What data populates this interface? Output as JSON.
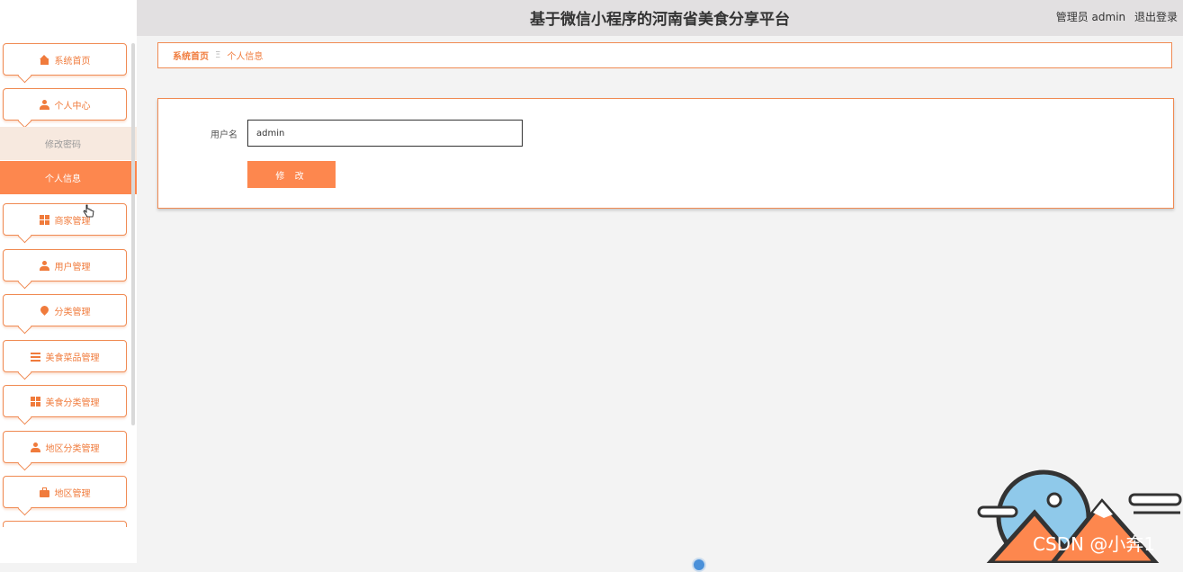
{
  "header": {
    "title": "基于微信小程序的河南省美食分享平台",
    "user_label": "管理员 admin",
    "logout_label": "退出登录"
  },
  "sidebar": {
    "items": [
      {
        "label": "系统首页",
        "icon": "home-icon"
      },
      {
        "label": "个人中心",
        "icon": "user-icon"
      },
      {
        "label": "商家管理",
        "icon": "grid-icon"
      },
      {
        "label": "用户管理",
        "icon": "user-icon"
      },
      {
        "label": "分类管理",
        "icon": "pin-icon"
      },
      {
        "label": "美食菜品管理",
        "icon": "list-icon"
      },
      {
        "label": "美食分类管理",
        "icon": "grid-icon"
      },
      {
        "label": "地区分类管理",
        "icon": "user-icon"
      },
      {
        "label": "地区管理",
        "icon": "briefcase-icon"
      }
    ],
    "subitems": [
      {
        "label": "修改密码",
        "active": false
      },
      {
        "label": "个人信息",
        "active": true
      }
    ]
  },
  "breadcrumb": {
    "home": "系统首页",
    "separator": "Ξ",
    "current": "个人信息"
  },
  "form": {
    "username_label": "用户名",
    "username_value": "admin",
    "submit_label": "修 改"
  },
  "watermark": "CSDN @小奔1",
  "colors": {
    "accent": "#fd874e",
    "border": "#f08a52",
    "header_bg": "#e2e0e1"
  }
}
